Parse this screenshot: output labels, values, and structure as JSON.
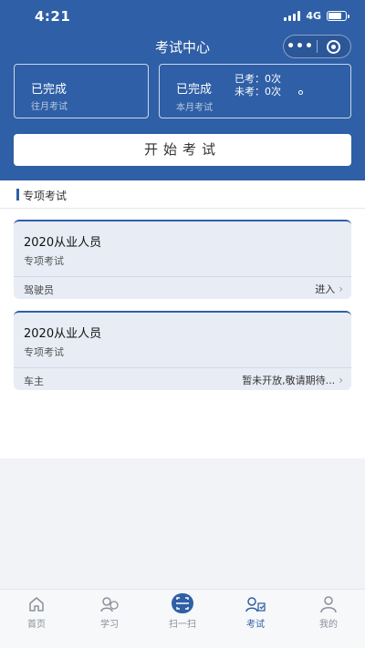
{
  "status": {
    "time": "4:21",
    "network": "4G"
  },
  "nav": {
    "title": "考试中心",
    "more_glyph": "•••"
  },
  "stats": {
    "left": {
      "main": "已完成",
      "sub": "往月考试"
    },
    "right": {
      "main": "已完成",
      "sub": "本月考试",
      "taken": "已考：0次",
      "untaken": "未考：0次"
    }
  },
  "start_button": "开始考试",
  "section": {
    "title": "专项考试"
  },
  "exams": [
    {
      "title": "2020从业人员",
      "type": "专项考试",
      "role": "驾驶员",
      "action": "进入"
    },
    {
      "title": "2020从业人员",
      "type": "专项考试",
      "role": "车主",
      "action": "暂未开放,敬请期待..."
    }
  ],
  "tabbar": [
    {
      "label": "首页",
      "icon": "home-icon"
    },
    {
      "label": "学习",
      "icon": "study-icon"
    },
    {
      "label": "扫一扫",
      "icon": "scan-icon"
    },
    {
      "label": "考试",
      "icon": "exam-icon",
      "active": true
    },
    {
      "label": "我的",
      "icon": "profile-icon"
    }
  ],
  "colors": {
    "primary": "#2f5fa6",
    "card_bg": "#e8ecf5",
    "page_bg": "#f2f3f6"
  }
}
